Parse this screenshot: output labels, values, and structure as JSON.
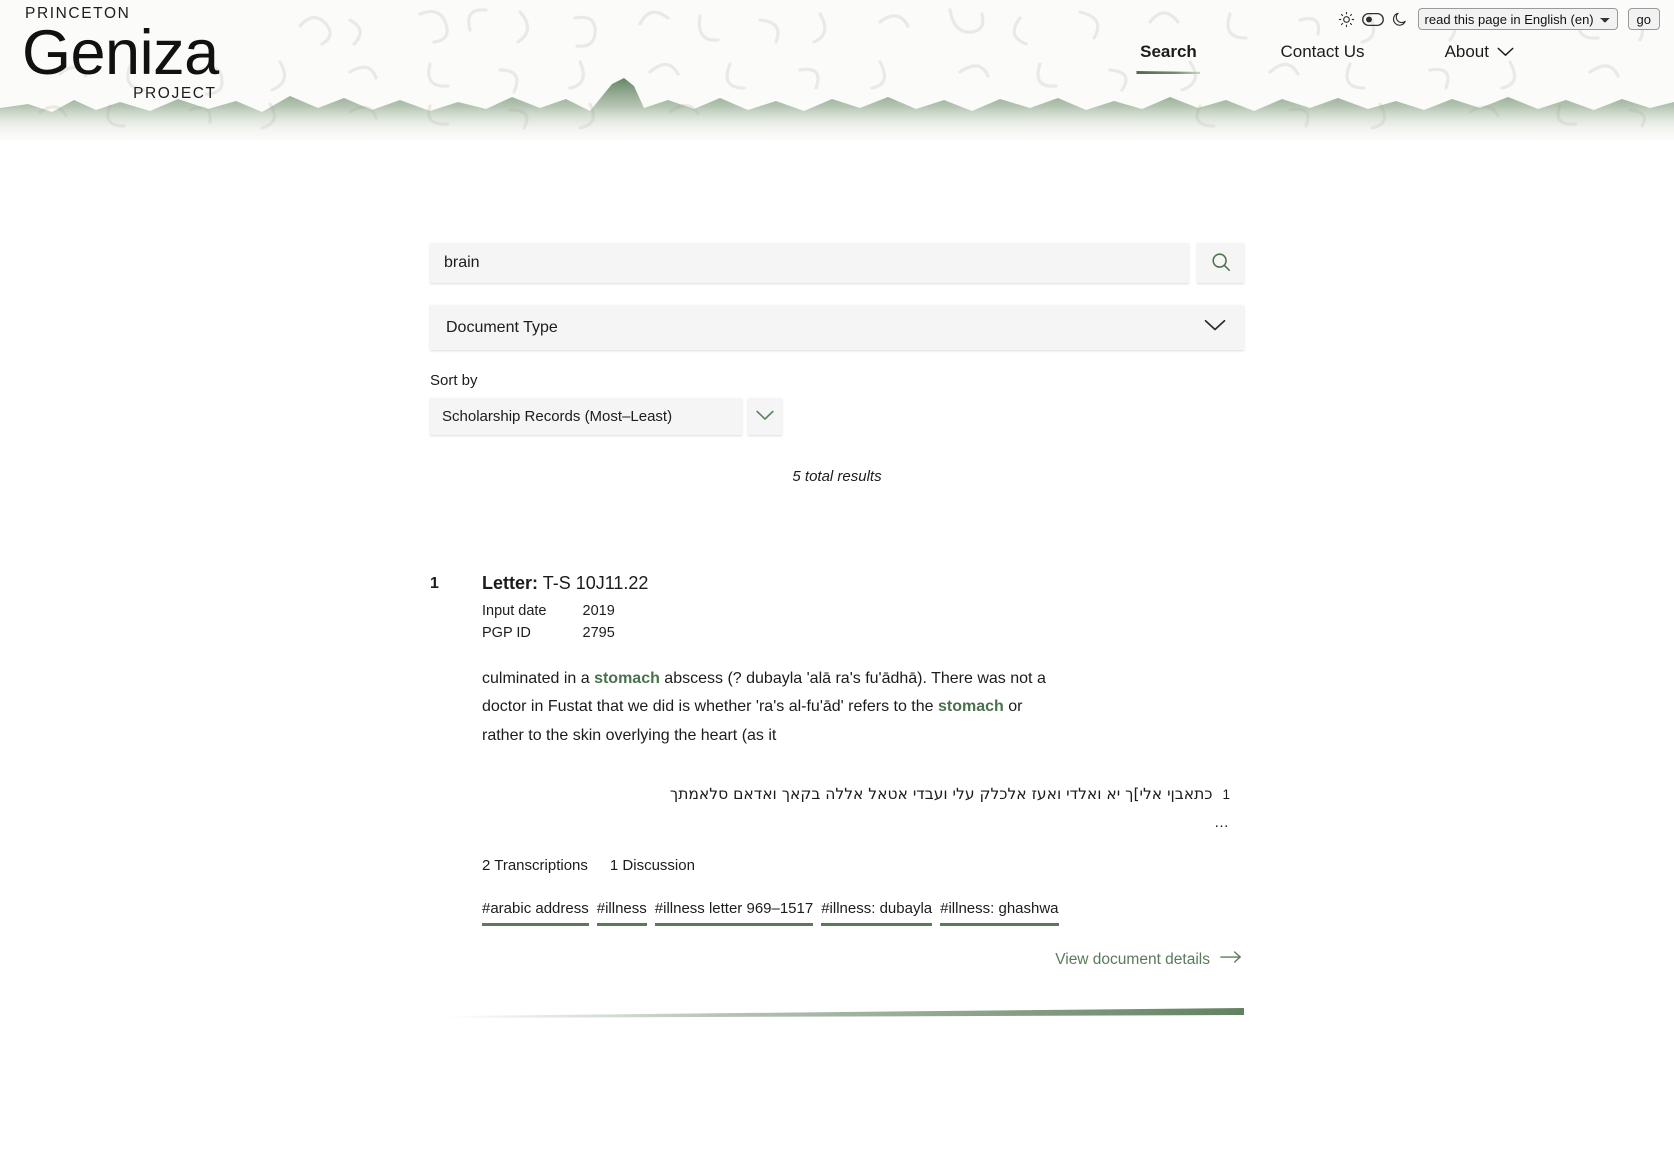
{
  "header": {
    "brand": {
      "line1": "PRINCETON",
      "line2": "Geniza",
      "line3": "PROJECT"
    },
    "theme": {
      "light_icon": "sun-icon",
      "toggle_icon": "theme-switch-icon",
      "dark_icon": "moon-icon"
    },
    "translate": {
      "selected": "read this page in English (en)",
      "options": [
        "read this page in English (en)"
      ],
      "go_label": "go"
    },
    "nav": [
      {
        "label": "Search",
        "active": true,
        "caret": false
      },
      {
        "label": "Contact Us",
        "active": false,
        "caret": false
      },
      {
        "label": "About",
        "active": false,
        "caret": true
      }
    ]
  },
  "search": {
    "query": "brain",
    "placeholder": "",
    "submit_icon": "search-icon",
    "doctype_filter": {
      "label": "Document Type",
      "caret_icon": "chevron-down-icon"
    },
    "sort": {
      "label": "Sort by",
      "value": "Scholarship Records (Most–Least)",
      "caret_icon": "chevron-down-icon",
      "options": [
        "Scholarship Records (Most–Least)"
      ]
    },
    "total_results": "5 total results"
  },
  "results": [
    {
      "number": "1",
      "doctype": "Letter:",
      "shelfmark": "T-S 10J11.22",
      "meta": [
        {
          "label": "Input date",
          "value": "2019"
        },
        {
          "label": "PGP ID",
          "value": "2795"
        }
      ],
      "snippet": {
        "parts": [
          {
            "text": "culminated in a ",
            "highlight": false
          },
          {
            "text": "stomach",
            "highlight": true
          },
          {
            "text": " abscess (? dubayla 'alā ra's fu'ādhā). There was not a doctor in Fustat that we did is whether 'ra's al-fu'ād' refers to the ",
            "highlight": false
          },
          {
            "text": "stomach",
            "highlight": true
          },
          {
            "text": " or rather to the skin overlying the heart (as it",
            "highlight": false
          }
        ]
      },
      "transcription": {
        "line_number": "1",
        "text": "כתאבןי אלי]ך יא ואלדי ואעז אלכלק עלי ועבדי אטאל אללה בקאך ואדאם סלאמתך",
        "ellipsis": "…"
      },
      "counts": [
        "2 Transcriptions",
        "1 Discussion"
      ],
      "tags": [
        "#arabic address",
        "#illness",
        "#illness letter 969–1517",
        "#illness: dubayla",
        "#illness: ghashwa"
      ],
      "details_link": "View document details",
      "details_arrow_icon": "arrow-right-icon"
    }
  ],
  "colors": {
    "accent_green": "#5a7a58",
    "highlight_green": "#49714b",
    "field_bg": "#f5f5f5"
  }
}
